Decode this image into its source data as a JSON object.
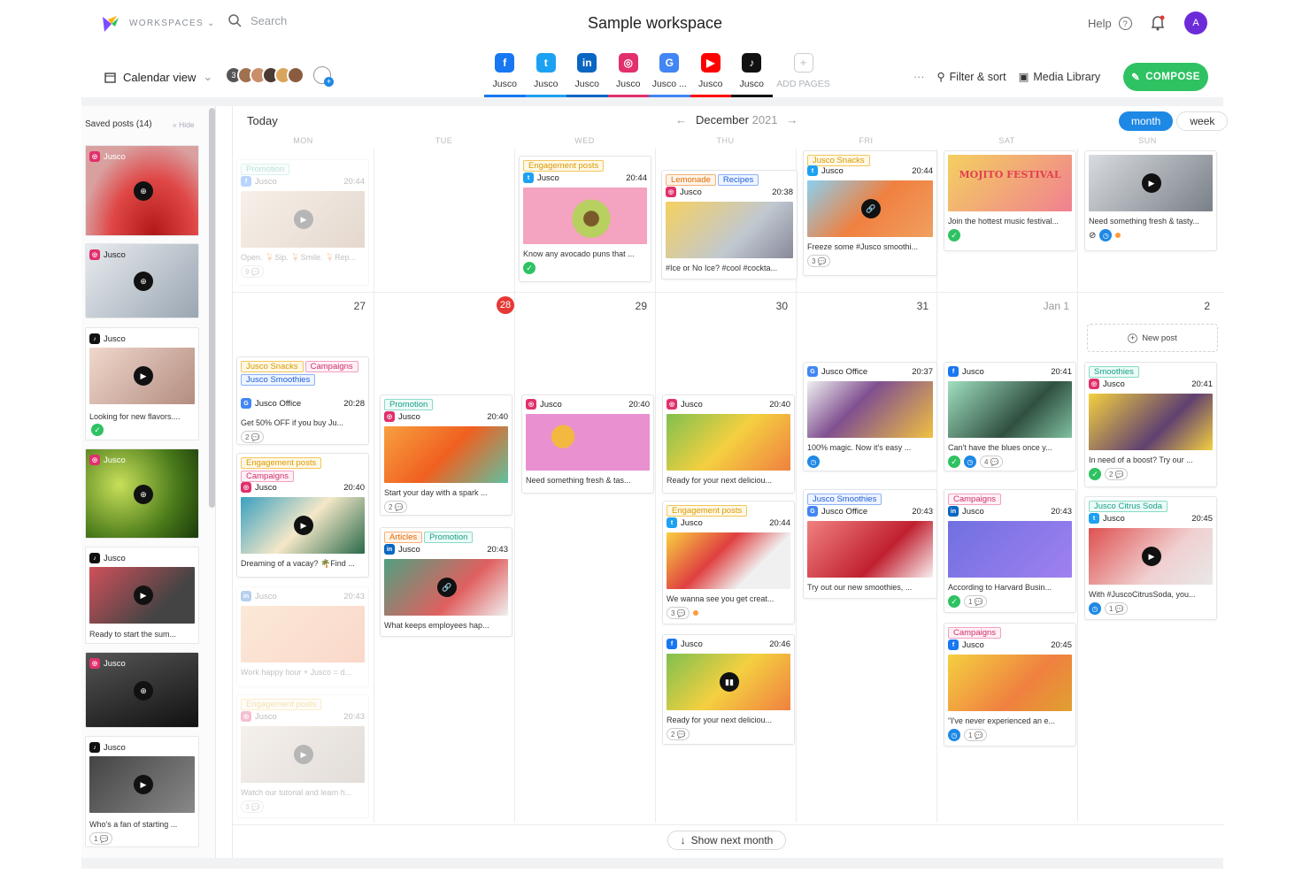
{
  "top": {
    "workspaces": "WORKSPACES",
    "search_placeholder": "Search",
    "title": "Sample workspace",
    "help": "Help",
    "avatar": "A"
  },
  "toolbar": {
    "calendar_view": "Calendar view",
    "filter_sort": "Filter & sort",
    "media_library": "Media Library",
    "compose": "COMPOSE",
    "more": "···"
  },
  "team_count": "3",
  "pages": [
    {
      "label": "Jusco",
      "icon": "facebook-icon",
      "color": "#1877f2",
      "glyph": "f"
    },
    {
      "label": "Jusco",
      "icon": "twitter-icon",
      "color": "#1da1f2",
      "glyph": "t"
    },
    {
      "label": "Jusco",
      "icon": "linkedin-icon",
      "color": "#0a66c2",
      "glyph": "in"
    },
    {
      "label": "Jusco",
      "icon": "instagram-icon",
      "color": "#e1306c",
      "glyph": "◎"
    },
    {
      "label": "Jusco ...",
      "icon": "google-icon",
      "color": "#4285f4",
      "glyph": "G"
    },
    {
      "label": "Jusco",
      "icon": "youtube-icon",
      "color": "#ff0000",
      "glyph": "▶"
    },
    {
      "label": "Jusco",
      "icon": "tiktok-icon",
      "color": "#111111",
      "glyph": "♪"
    }
  ],
  "add_pages": "ADD PAGES",
  "sidebar": {
    "title": "Saved posts (14)",
    "hide": "« Hide",
    "posts": [
      {
        "net": "Jusco",
        "text": ""
      },
      {
        "net": "Jusco",
        "text": ""
      },
      {
        "net": "Jusco",
        "text": "Looking for new flavors...."
      },
      {
        "net": "Jusco",
        "text": ""
      },
      {
        "net": "Jusco",
        "text": "Ready to start the sum..."
      },
      {
        "net": "Jusco",
        "text": ""
      },
      {
        "net": "Jusco",
        "text": "Who's a fan of starting ...",
        "comments": "1"
      }
    ]
  },
  "calendar": {
    "today": "Today",
    "month": "December",
    "year": "2021",
    "view_month": "month",
    "view_week": "week",
    "days": [
      "MON",
      "TUE",
      "WED",
      "THU",
      "FRI",
      "SAT",
      "SUN"
    ],
    "dates": [
      "27",
      "28",
      "29",
      "30",
      "31",
      "Jan 1",
      "2"
    ],
    "new_post": "New post",
    "show_next": "Show next month"
  },
  "posts": {
    "w1_mon": {
      "tag": "Promotion",
      "net": "Jusco",
      "time": "20:44",
      "text": "Open. 🍹Sip. 🍹Smile. 🍹Rep...",
      "comments": "9"
    },
    "w1_wed": {
      "tag": "Engagement posts",
      "net": "Jusco",
      "time": "20:44",
      "text": "Know any avocado puns that ..."
    },
    "w1_thu": {
      "tags": [
        "Lemonade",
        "Recipes"
      ],
      "net": "Jusco",
      "time": "20:38",
      "text": "#Ice or No Ice? #cool #cockta..."
    },
    "w1_fri": {
      "tag": "Jusco Snacks",
      "net": "Jusco",
      "time": "20:44",
      "text": "Freeze some #Jusco smoothi...",
      "comments": "3"
    },
    "w1_sat": {
      "text": "Join the hottest music festival...",
      "img_title": "MOJITO FESTIVAL"
    },
    "w1_sun": {
      "text": "Need something fresh & tasty..."
    },
    "mon_1": {
      "tags": [
        "Jusco Snacks",
        "Campaigns",
        "Jusco Smoothies"
      ],
      "net": "Jusco Office",
      "time": "20:28",
      "text": "Get 50% OFF if you buy Ju...",
      "comments": "2"
    },
    "mon_2": {
      "tags": [
        "Engagement posts",
        "Campaigns"
      ],
      "net": "Jusco",
      "time": "20:40",
      "text": "Dreaming of a vacay? 🌴Find ..."
    },
    "mon_3": {
      "net": "Jusco",
      "time": "20:43",
      "text": "Work happy hour + Jusco = d..."
    },
    "mon_4": {
      "tag": "Engagement posts",
      "net": "Jusco",
      "time": "20:43",
      "text": "Watch our tutorial and learn h...",
      "comments": "3"
    },
    "tue_1": {
      "tag": "Promotion",
      "net": "Jusco",
      "time": "20:40",
      "text": "Start your day with a spark ...",
      "comments": "2"
    },
    "tue_2": {
      "tags": [
        "Articles",
        "Promotion"
      ],
      "net": "Jusco",
      "time": "20:43",
      "text": "What keeps employees hap..."
    },
    "wed_1": {
      "net": "Jusco",
      "time": "20:40",
      "text": "Need something fresh & tas..."
    },
    "thu_1": {
      "net": "Jusco",
      "time": "20:40",
      "text": "Ready for your next deliciou..."
    },
    "thu_2": {
      "tag": "Engagement posts",
      "net": "Jusco",
      "time": "20:44",
      "text": "We wanna see you get creat...",
      "comments": "3"
    },
    "thu_3": {
      "net": "Jusco",
      "time": "20:46",
      "text": "Ready for your next deliciou...",
      "comments": "2"
    },
    "fri_1": {
      "net": "Jusco Office",
      "time": "20:37",
      "text": "100% magic. Now it's easy ..."
    },
    "fri_2": {
      "tag": "Jusco Smoothies",
      "net": "Jusco Office",
      "time": "20:43",
      "text": "Try out our new smoothies, ..."
    },
    "sat_1": {
      "net": "Jusco",
      "time": "20:41",
      "text": "Can't have the blues once y...",
      "comments": "4"
    },
    "sat_2": {
      "tag": "Campaigns",
      "net": "Jusco",
      "time": "20:43",
      "text": "According to Harvard Busin...",
      "comments": "1"
    },
    "sat_3": {
      "tag": "Campaigns",
      "net": "Jusco",
      "time": "20:45",
      "text": "\"I've never experienced an e...",
      "comments": "1"
    },
    "sun_1": {
      "tag": "Smoothies",
      "net": "Jusco",
      "time": "20:41",
      "text": "In need of a boost? Try our ...",
      "comments": "2"
    },
    "sun_2": {
      "tag": "Jusco Citrus Soda",
      "net": "Jusco",
      "time": "20:45",
      "text": "With #JuscoCitrusSoda, you...",
      "comments": "1"
    }
  }
}
